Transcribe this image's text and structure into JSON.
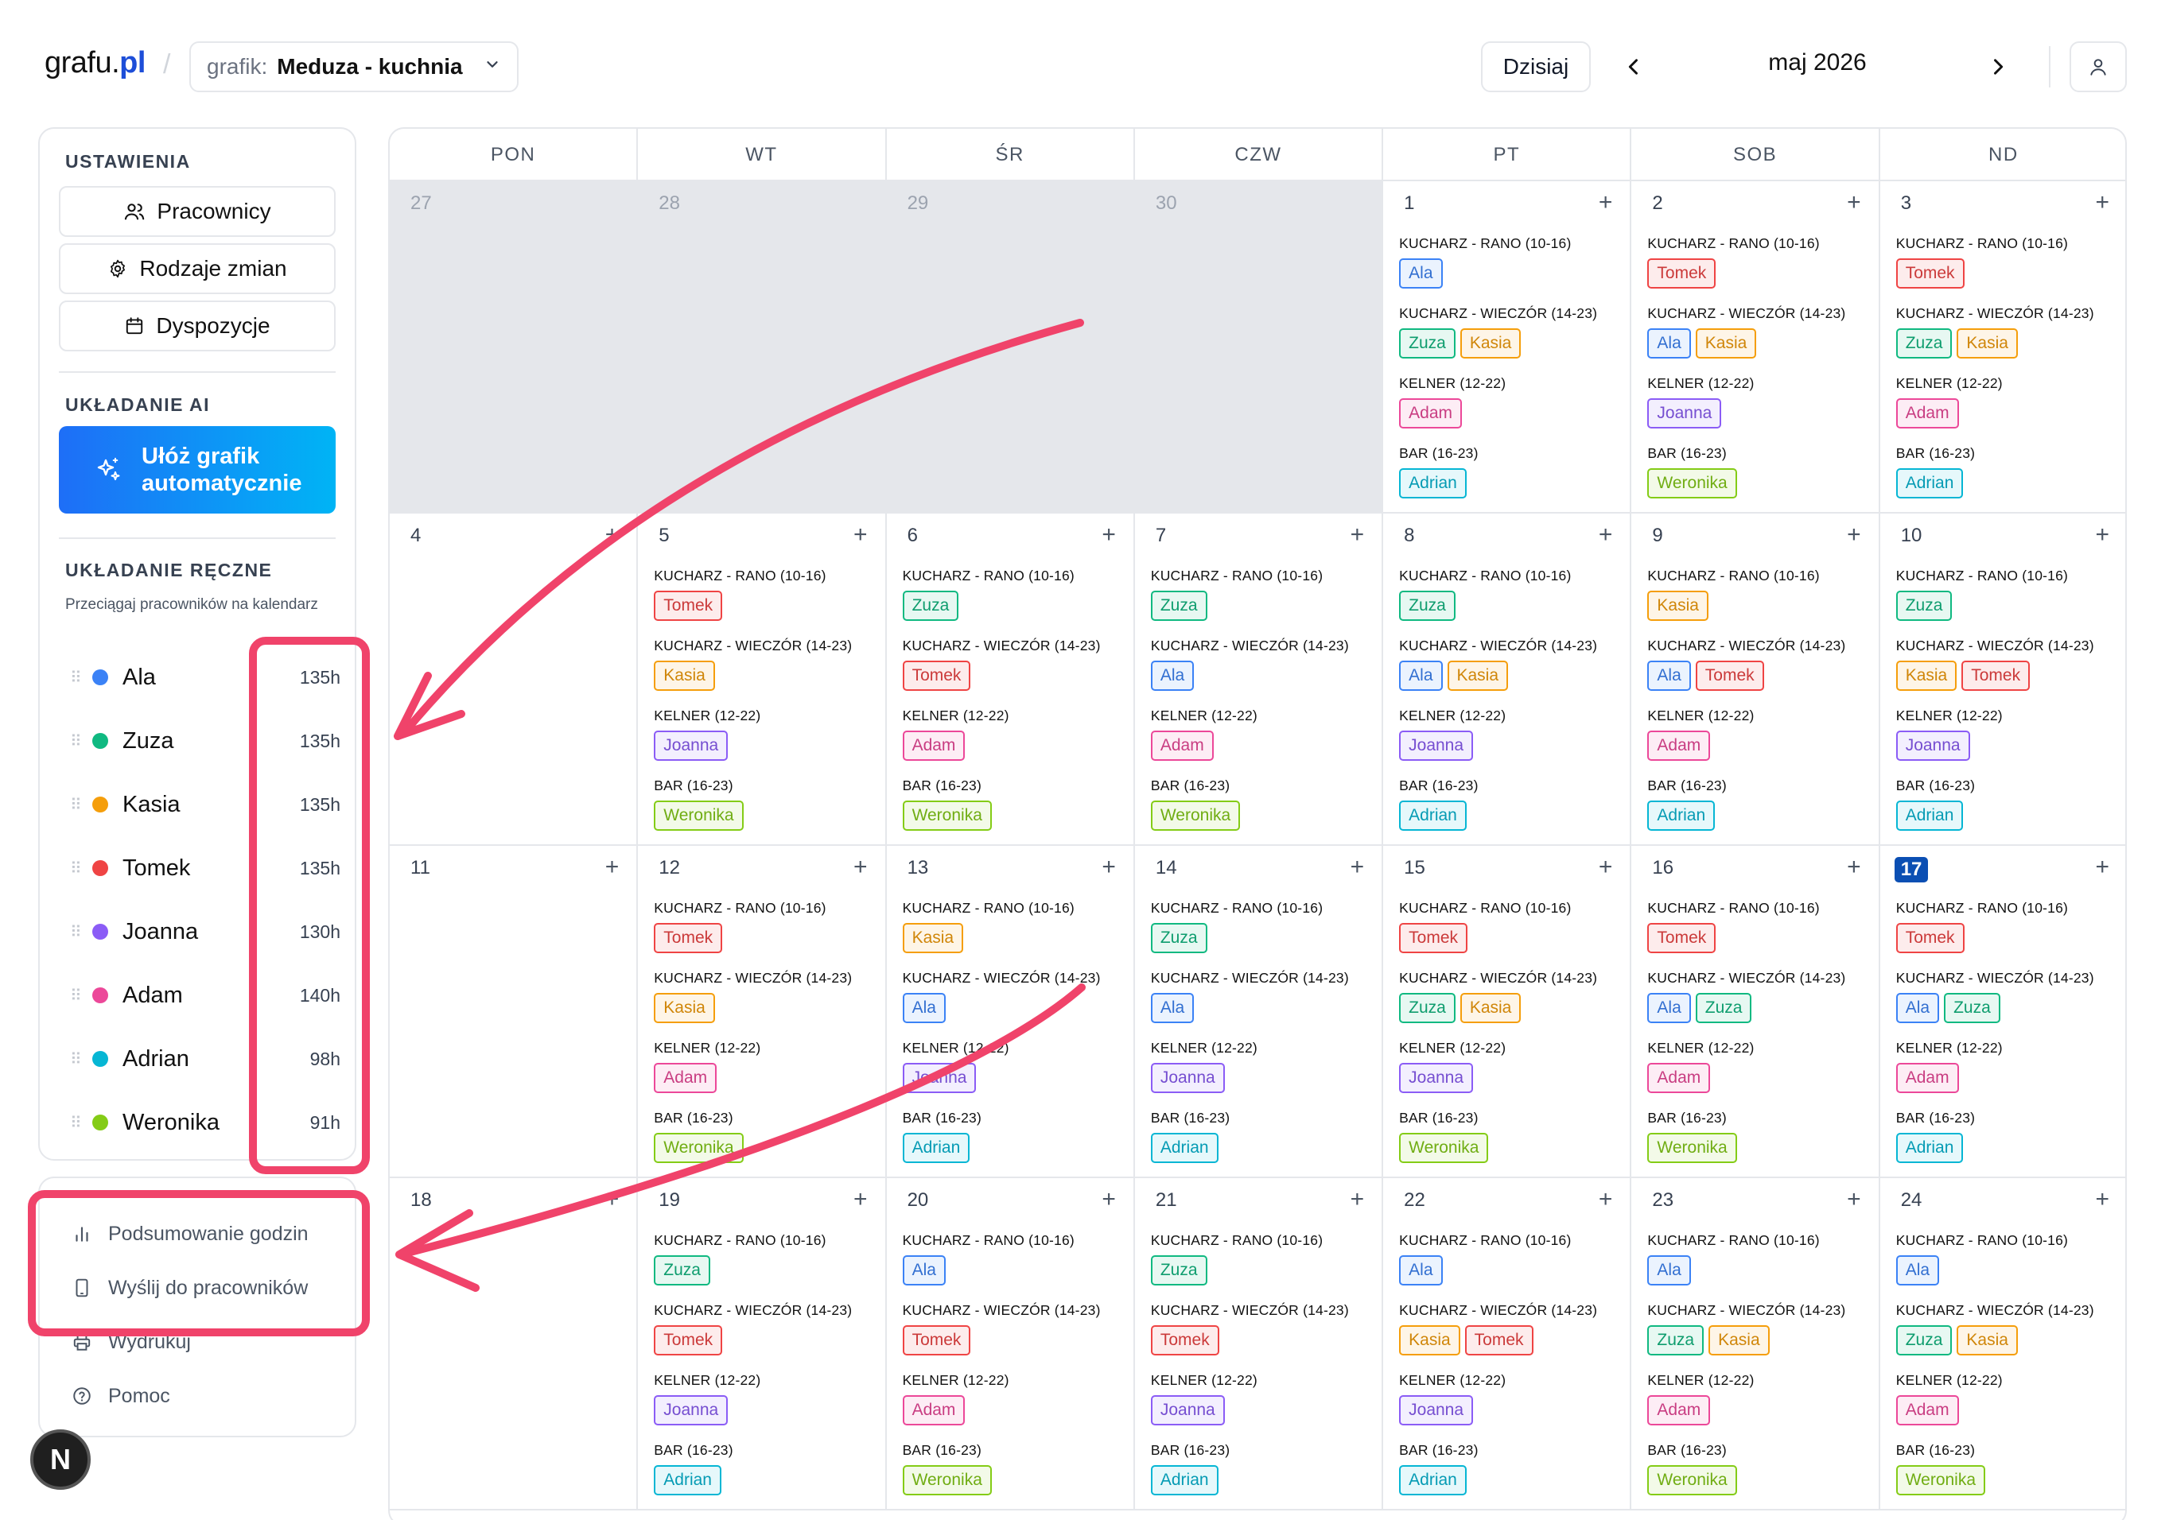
{
  "header": {
    "logo_main": "grafu.",
    "logo_tld": "pl",
    "schedule_label": "grafik:",
    "schedule_value": "Meduza - kuchnia",
    "today_label": "Dzisiaj",
    "month_label": "maj 2026"
  },
  "sidebar": {
    "settings_title": "USTAWIENIA",
    "btn_employees": "Pracownicy",
    "btn_shift_types": "Rodzaje zmian",
    "btn_availability": "Dyspozycje",
    "ai_title": "UKŁADANIE AI",
    "ai_button": "Ułóż grafik automatycznie",
    "manual_title": "UKŁADANIE RĘCZNE",
    "manual_hint": "Przeciągaj pracowników na kalendarz",
    "employees": [
      {
        "name": "Ala",
        "hours": "135h",
        "color": "#3b82f6"
      },
      {
        "name": "Zuza",
        "hours": "135h",
        "color": "#10b981"
      },
      {
        "name": "Kasia",
        "hours": "135h",
        "color": "#f59e0b"
      },
      {
        "name": "Tomek",
        "hours": "135h",
        "color": "#ef4444"
      },
      {
        "name": "Joanna",
        "hours": "130h",
        "color": "#8b5cf6"
      },
      {
        "name": "Adam",
        "hours": "140h",
        "color": "#ec4899"
      },
      {
        "name": "Adrian",
        "hours": "98h",
        "color": "#06b6d4"
      },
      {
        "name": "Weronika",
        "hours": "91h",
        "color": "#84cc16"
      }
    ],
    "bottom": {
      "summary": "Podsumowanie godzin",
      "send": "Wyślij do pracowników",
      "print": "Wydrukuj",
      "help": "Pomoc"
    },
    "badge": "N"
  },
  "calendar": {
    "weekdays": [
      "PON",
      "WT",
      "ŚR",
      "CZW",
      "PT",
      "SOB",
      "ND"
    ],
    "shift_names": [
      "KUCHARZ - RANO (10-16)",
      "KUCHARZ - WIECZÓR (14-23)",
      "KELNER (12-22)",
      "BAR (16-23)"
    ],
    "weeks": [
      [
        {
          "day": "27",
          "out": true
        },
        {
          "day": "28",
          "out": true
        },
        {
          "day": "29",
          "out": true
        },
        {
          "day": "30",
          "out": true
        },
        {
          "day": "1",
          "shifts": [
            [
              "Ala"
            ],
            [
              "Zuza",
              "Kasia"
            ],
            [
              "Adam"
            ],
            [
              "Adrian"
            ]
          ]
        },
        {
          "day": "2",
          "shifts": [
            [
              "Tomek"
            ],
            [
              "Ala",
              "Kasia"
            ],
            [
              "Joanna"
            ],
            [
              "Weronika"
            ]
          ]
        },
        {
          "day": "3",
          "shifts": [
            [
              "Tomek"
            ],
            [
              "Zuza",
              "Kasia"
            ],
            [
              "Adam"
            ],
            [
              "Adrian"
            ]
          ]
        }
      ],
      [
        {
          "day": "4",
          "shifts": []
        },
        {
          "day": "5",
          "shifts": [
            [
              "Tomek"
            ],
            [
              "Kasia"
            ],
            [
              "Joanna"
            ],
            [
              "Weronika"
            ]
          ]
        },
        {
          "day": "6",
          "shifts": [
            [
              "Zuza"
            ],
            [
              "Tomek"
            ],
            [
              "Adam"
            ],
            [
              "Weronika"
            ]
          ]
        },
        {
          "day": "7",
          "shifts": [
            [
              "Zuza"
            ],
            [
              "Ala"
            ],
            [
              "Adam"
            ],
            [
              "Weronika"
            ]
          ]
        },
        {
          "day": "8",
          "shifts": [
            [
              "Zuza"
            ],
            [
              "Ala",
              "Kasia"
            ],
            [
              "Joanna"
            ],
            [
              "Adrian"
            ]
          ]
        },
        {
          "day": "9",
          "shifts": [
            [
              "Kasia"
            ],
            [
              "Ala",
              "Tomek"
            ],
            [
              "Adam"
            ],
            [
              "Adrian"
            ]
          ]
        },
        {
          "day": "10",
          "shifts": [
            [
              "Zuza"
            ],
            [
              "Kasia",
              "Tomek"
            ],
            [
              "Joanna"
            ],
            [
              "Adrian"
            ]
          ]
        }
      ],
      [
        {
          "day": "11",
          "shifts": []
        },
        {
          "day": "12",
          "shifts": [
            [
              "Tomek"
            ],
            [
              "Kasia"
            ],
            [
              "Adam"
            ],
            [
              "Weronika"
            ]
          ]
        },
        {
          "day": "13",
          "shifts": [
            [
              "Kasia"
            ],
            [
              "Ala"
            ],
            [
              "Joanna"
            ],
            [
              "Adrian"
            ]
          ]
        },
        {
          "day": "14",
          "shifts": [
            [
              "Zuza"
            ],
            [
              "Ala"
            ],
            [
              "Joanna"
            ],
            [
              "Adrian"
            ]
          ]
        },
        {
          "day": "15",
          "shifts": [
            [
              "Tomek"
            ],
            [
              "Zuza",
              "Kasia"
            ],
            [
              "Joanna"
            ],
            [
              "Weronika"
            ]
          ]
        },
        {
          "day": "16",
          "shifts": [
            [
              "Tomek"
            ],
            [
              "Ala",
              "Zuza"
            ],
            [
              "Adam"
            ],
            [
              "Weronika"
            ]
          ]
        },
        {
          "day": "17",
          "today": true,
          "shifts": [
            [
              "Tomek"
            ],
            [
              "Ala",
              "Zuza"
            ],
            [
              "Adam"
            ],
            [
              "Adrian"
            ]
          ]
        }
      ],
      [
        {
          "day": "18",
          "shifts": []
        },
        {
          "day": "19",
          "shifts": [
            [
              "Zuza"
            ],
            [
              "Tomek"
            ],
            [
              "Joanna"
            ],
            [
              "Adrian"
            ]
          ]
        },
        {
          "day": "20",
          "shifts": [
            [
              "Ala"
            ],
            [
              "Tomek"
            ],
            [
              "Adam"
            ],
            [
              "Weronika"
            ]
          ]
        },
        {
          "day": "21",
          "shifts": [
            [
              "Zuza"
            ],
            [
              "Tomek"
            ],
            [
              "Joanna"
            ],
            [
              "Adrian"
            ]
          ]
        },
        {
          "day": "22",
          "shifts": [
            [
              "Ala"
            ],
            [
              "Kasia",
              "Tomek"
            ],
            [
              "Joanna"
            ],
            [
              "Adrian"
            ]
          ]
        },
        {
          "day": "23",
          "shifts": [
            [
              "Ala"
            ],
            [
              "Zuza",
              "Kasia"
            ],
            [
              "Adam"
            ],
            [
              "Weronika"
            ]
          ]
        },
        {
          "day": "24",
          "shifts": [
            [
              "Ala"
            ],
            [
              "Zuza",
              "Kasia"
            ],
            [
              "Adam"
            ],
            [
              "Weronika"
            ]
          ]
        }
      ]
    ]
  },
  "colors": {
    "accent": "#1d4ed8",
    "today_badge": "#0b4fb3",
    "annotation": "#f0436a",
    "out_of_month": "#e5e7eb"
  }
}
